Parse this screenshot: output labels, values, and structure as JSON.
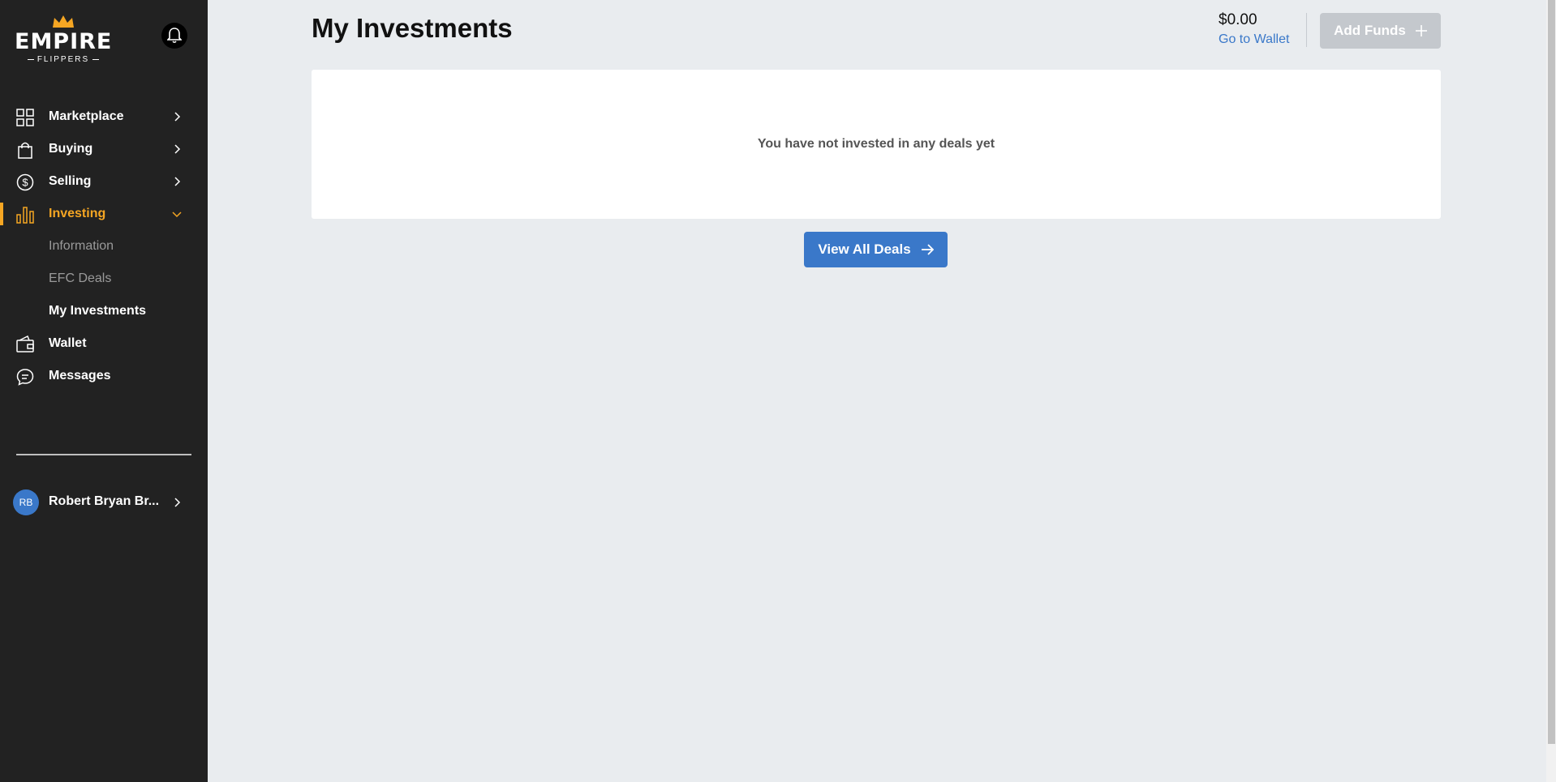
{
  "brand": {
    "name": "EMPIRE",
    "tagline": "FLIPPERS",
    "accent": "#f5a623"
  },
  "sidebar": {
    "items": [
      {
        "label": "Marketplace",
        "icon": "grid-icon"
      },
      {
        "label": "Buying",
        "icon": "shopping-bag-icon"
      },
      {
        "label": "Selling",
        "icon": "dollar-circle-icon"
      },
      {
        "label": "Investing",
        "icon": "bar-chart-icon",
        "active": true
      },
      {
        "label": "Wallet",
        "icon": "wallet-icon"
      },
      {
        "label": "Messages",
        "icon": "chat-icon"
      }
    ],
    "investing_sub": [
      {
        "label": "Information"
      },
      {
        "label": "EFC Deals"
      },
      {
        "label": "My Investments",
        "current": true
      }
    ],
    "user": {
      "initials": "RB",
      "name": "Robert Bryan Br..."
    }
  },
  "header": {
    "title": "My Investments",
    "balance": "$0.00",
    "wallet_link": "Go to Wallet",
    "add_funds": "Add Funds"
  },
  "main": {
    "empty_message": "You have not invested in any deals yet",
    "view_all": "View All Deals",
    "primary_color": "#3a78c9"
  }
}
